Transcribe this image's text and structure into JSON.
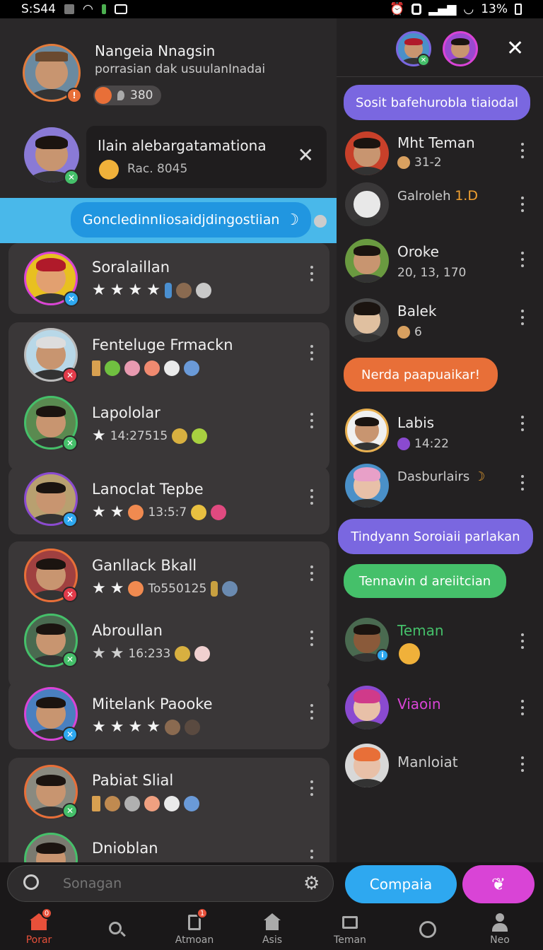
{
  "status": {
    "time": "S:S44",
    "battery": "13%"
  },
  "profile": {
    "name": "Nangeia Nnagsin",
    "subtitle": "porrasian dak usuulanInadai",
    "count": "380"
  },
  "notification": {
    "title": "Ilain alebargatamationa",
    "meta": "Rac. 8045"
  },
  "banner": {
    "text": "GoncledinnIiosaidjdingostiian"
  },
  "left_items": [
    {
      "name": "Soralaillan",
      "meta": ""
    },
    {
      "name": "Fenteluge Frmackn",
      "meta": ""
    },
    {
      "name": "Lapololar",
      "meta": "14:27515"
    },
    {
      "name": "Lanoclat Tepbe",
      "meta": "13:5:7"
    },
    {
      "name": "Ganllack Bkall",
      "meta": "To550125"
    },
    {
      "name": "Abroullan",
      "meta": "16:233"
    },
    {
      "name": "Mitelank Paooke",
      "meta": ""
    },
    {
      "name": "Pabiat Slial",
      "meta": ""
    },
    {
      "name": "Dnioblan",
      "meta": ""
    }
  ],
  "right": {
    "bubble1": "Sosit bafehurobla tiaiodal",
    "items": [
      {
        "name": "Mht Teman",
        "meta": "31-2"
      },
      {
        "name": "Galroleh",
        "tag": "1.D"
      },
      {
        "name": "Oroke",
        "meta": "20, 13, 170"
      },
      {
        "name": "Balek",
        "meta": "6"
      },
      {
        "name": "Labis",
        "meta": "14:22"
      },
      {
        "name": "Dasburlairs"
      },
      {
        "name": "Teman"
      },
      {
        "name": "Viaoin"
      },
      {
        "name": "Manloiat"
      }
    ],
    "bubble2": "Nerda paapuaikar!",
    "bubble3": "Tindyann Soroiaii parlakan",
    "bubble4": "Tennavin d areiitcian"
  },
  "search": {
    "placeholder": "Sonagan"
  },
  "compose_label": "Compaia",
  "nav": [
    {
      "label": "Porar",
      "badge": "0"
    },
    {
      "label": ""
    },
    {
      "label": "Atmoan",
      "badge": "1"
    },
    {
      "label": "Asis"
    },
    {
      "label": "Teman"
    },
    {
      "label": ""
    },
    {
      "label": "Neo"
    }
  ],
  "colors": {
    "accent_blue": "#2ea8f0",
    "accent_purple": "#7a67e0",
    "accent_orange": "#e86f38",
    "accent_green": "#45c06a",
    "accent_pink": "#d944d6",
    "nav_active": "#e8503a"
  }
}
